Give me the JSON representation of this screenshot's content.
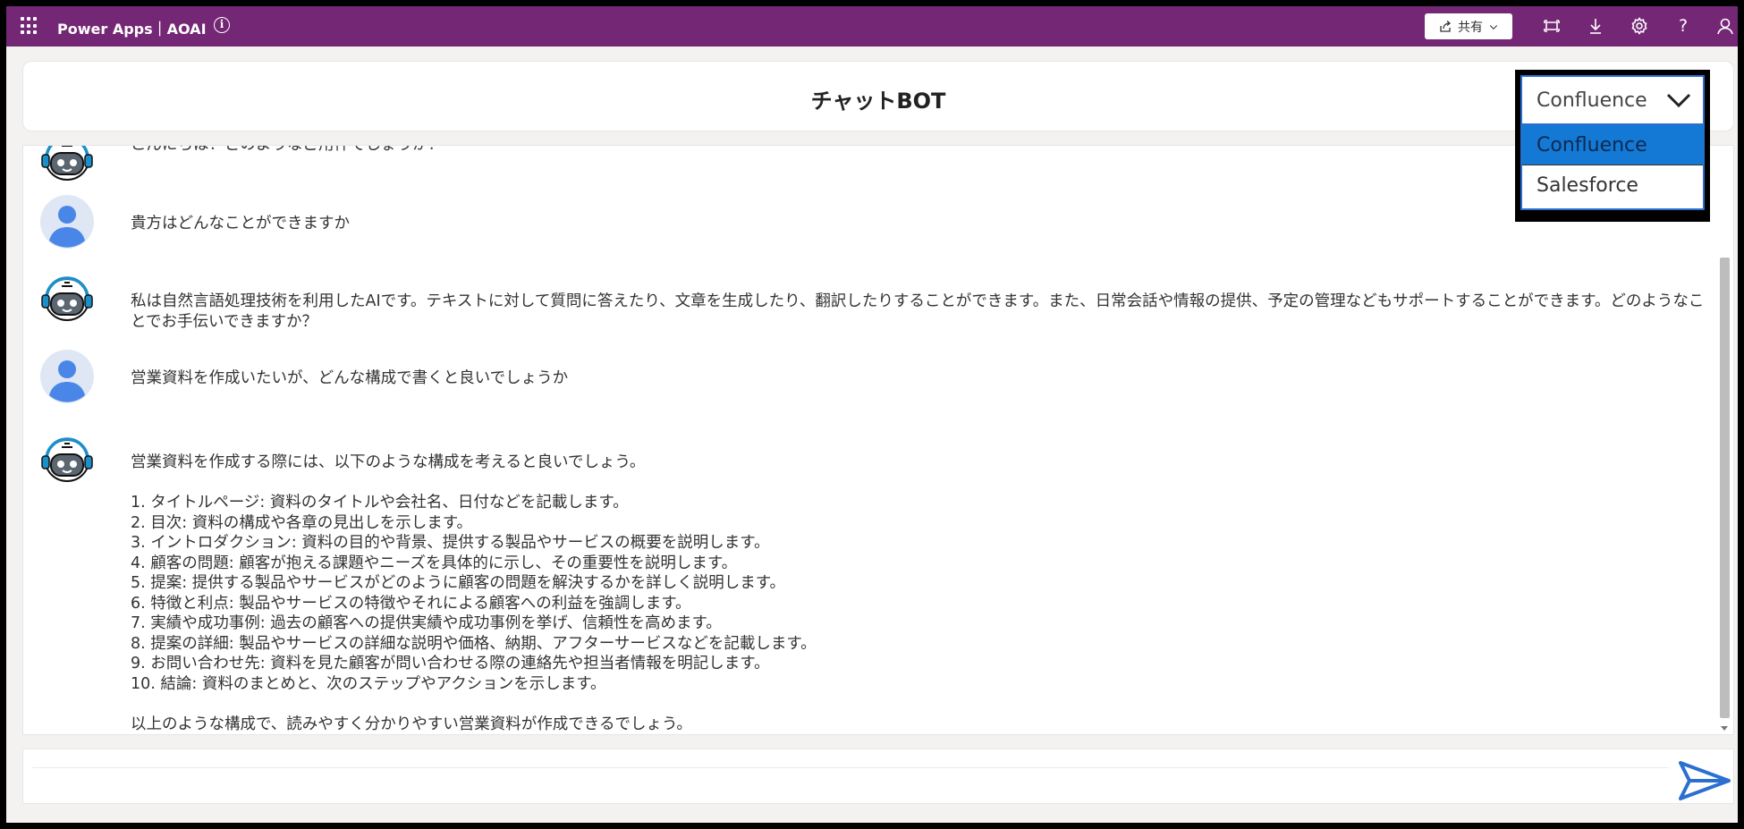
{
  "app": {
    "name": "Power Apps｜AOAI",
    "info_glyph": "i"
  },
  "toolbar": {
    "share_label": "共有",
    "help_glyph": "?",
    "icons": [
      "waffle-icon",
      "info-icon",
      "share-icon",
      "chevron-down-icon",
      "fit-screen-icon",
      "download-icon",
      "settings-icon",
      "help-icon",
      "user-icon"
    ]
  },
  "header": {
    "title": "チャットBOT"
  },
  "source_dropdown": {
    "selected": "Confluence",
    "options": [
      "Confluence",
      "Salesforce"
    ]
  },
  "chat": {
    "messages": [
      {
        "role": "bot",
        "text": "こんにちは！どのようなご用件でしょうか？"
      },
      {
        "role": "user",
        "text": "貴方はどんなことができますか"
      },
      {
        "role": "bot",
        "text": "私は自然言語処理技術を利用したAIです。テキストに対して質問に答えたり、文章を生成したり、翻訳したりすることができます。また、日常会話や情報の提供、予定の管理などもサポートすることができます。どのようなことでお手伝いできますか？"
      },
      {
        "role": "user",
        "text": "営業資料を作成いたいが、どんな構成で書くと良いでしょうか"
      },
      {
        "role": "bot",
        "text": "営業資料を作成する際には、以下のような構成を考えると良いでしょう。\n\n1. タイトルページ: 資料のタイトルや会社名、日付などを記載します。\n2. 目次: 資料の構成や各章の見出しを示します。\n3. イントロダクション: 資料の目的や背景、提供する製品やサービスの概要を説明します。\n4. 顧客の問題: 顧客が抱える課題やニーズを具体的に示し、その重要性を説明します。\n5. 提案: 提供する製品やサービスがどのように顧客の問題を解決するかを詳しく説明します。\n6. 特徴と利点: 製品やサービスの特徴やそれによる顧客への利益を強調します。\n7. 実績や成功事例: 過去の顧客への提供実績や成功事例を挙げ、信頼性を高めます。\n8. 提案の詳細: 製品やサービスの詳細な説明や価格、納期、アフターサービスなどを記載します。\n9. お問い合わせ先: 資料を見た顧客が問い合わせる際の連絡先や担当者情報を明記します。\n10. 結論: 資料のまとめと、次のステップやアクションを示します。\n\n以上のような構成で、読みやすく分かりやすい営業資料が作成できるでしょう。"
      }
    ]
  },
  "composer": {
    "value": "",
    "placeholder": ""
  },
  "colors": {
    "topbar": "#742774",
    "dropdown_selected": "#1479d4",
    "send_icon": "#2b6fd1",
    "user_avatar": "#4a86e8",
    "bot_headset": "#1a8fc9"
  }
}
